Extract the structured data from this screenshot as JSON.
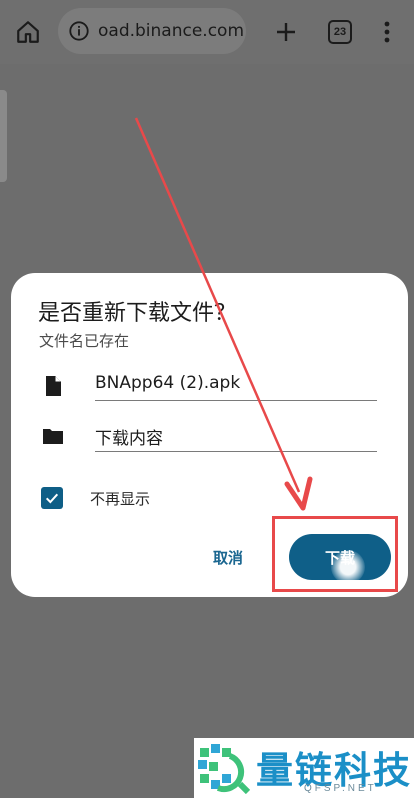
{
  "browser": {
    "url": "oad.binance.com",
    "tab_count": "23"
  },
  "dialog": {
    "title": "是否重新下载文件？",
    "subtitle": "文件名已存在",
    "file_name": "BNApp64 (2).apk",
    "location": "下载内容",
    "checkbox_label": "不再显示",
    "checkbox_checked": true,
    "cancel_label": "取消",
    "download_label": "下载"
  },
  "watermark": {
    "brand": "量链科技",
    "site": "QFSP.NET"
  },
  "colors": {
    "accent": "#0f5f88",
    "annotation": "#e8494a",
    "watermark": "#1b8fc7"
  }
}
